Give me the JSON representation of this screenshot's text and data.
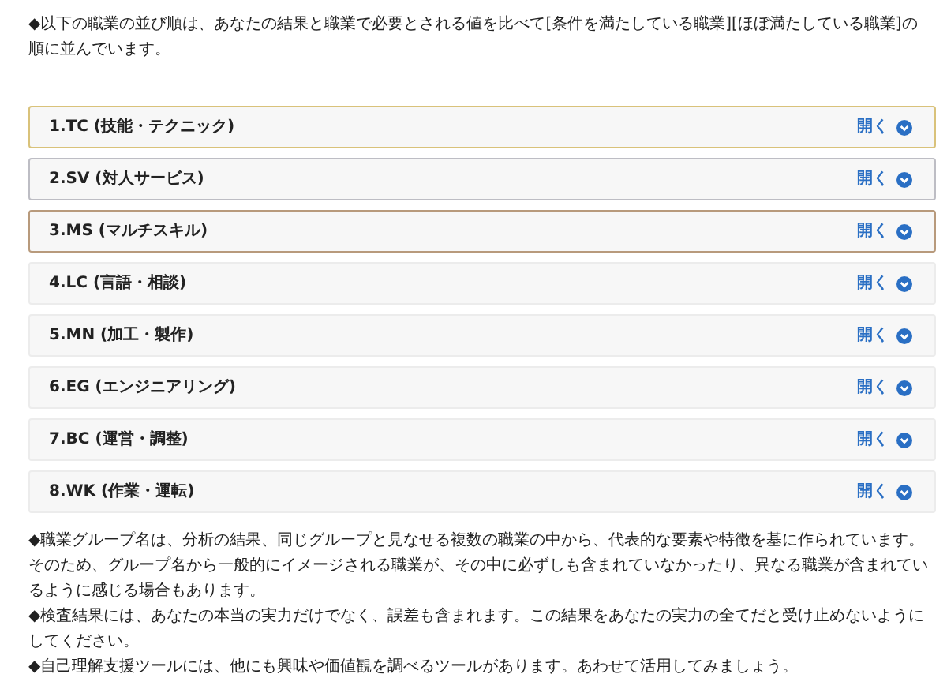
{
  "intro": "◆以下の職業の並び順は、あなたの結果と職業で必要とされる値を比べて[条件を満たしている職業][ほぼ満たしている職業]の順に並んでいます。",
  "groups": [
    {
      "title": "1.TC (技能・テクニック)",
      "toggle": "開く",
      "expanded": false,
      "color": "#d9c27a"
    },
    {
      "title": "2.SV (対人サービス)",
      "toggle": "開く",
      "expanded": false,
      "color": "#bdbdc4"
    },
    {
      "title": "3.MS (マルチスキル)",
      "toggle": "開く",
      "expanded": false,
      "color": "#b89a7c"
    },
    {
      "title": "4.LC (言語・相談)",
      "toggle": "開く",
      "expanded": false,
      "color": "#ececec"
    },
    {
      "title": "5.MN (加工・製作)",
      "toggle": "開く",
      "expanded": false,
      "color": "#ececec"
    },
    {
      "title": "6.EG (エンジニアリング)",
      "toggle": "開く",
      "expanded": false,
      "color": "#ececec"
    },
    {
      "title": "7.BC (運営・調整)",
      "toggle": "開く",
      "expanded": false,
      "color": "#ececec"
    },
    {
      "title": "8.WK (作業・運転)",
      "toggle": "開く",
      "expanded": false,
      "color": "#ececec"
    }
  ],
  "notes": [
    "◆職業グループ名は、分析の結果、同じグループと見なせる複数の職業の中から、代表的な要素や特徴を基に作られています。そのため、グループ名から一般的にイメージされる職業が、その中に必ずしも含まれていなかったり、異なる職業が含まれているように感じる場合もあります。",
    "◆検査結果には、あなたの本当の実力だけでなく、誤差も含まれます。この結果をあなたの実力の全てだと受け止めないようにしてください。",
    "◆自己理解支援ツールには、他にも興味や価値観を調べるツールがあります。あわせて活用してみましょう。"
  ]
}
